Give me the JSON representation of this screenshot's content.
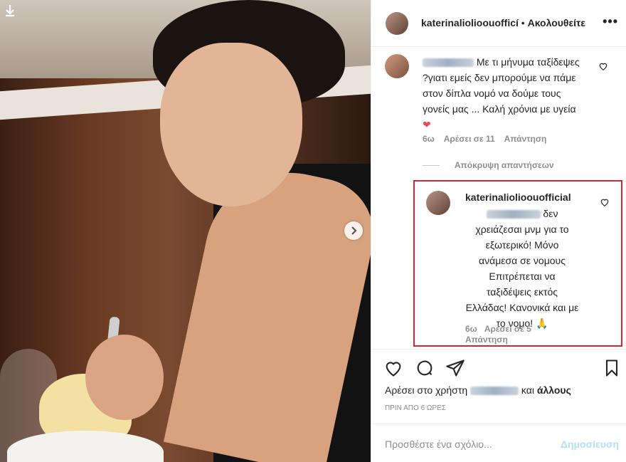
{
  "header": {
    "username": "katerinaliolioouofficí",
    "separator": "•",
    "follow_label": "Ακολουθείτε",
    "more_label": "•••"
  },
  "comment": {
    "text": "Με τι μήνυμα ταξίδεψες ?γιατι εμείς δεν μπορούμε να πάμε στον δίπλα νομό να δούμε τους γονείς μας ... Καλή χρόνια με υγεία",
    "emoji": "❤",
    "time": "6ω",
    "likes": "Αρέσει σε 11",
    "reply": "Απάντηση"
  },
  "hide_replies_label": "Απόκρυψη απαντήσεων",
  "reply": {
    "username": "katerinaliolioouofficial",
    "text_after_mention": "δεν χρειάζεσαι μνμ για το εξωτερικό! Μόνο ανάμεσα σε νομους Επιτρέπεται να ταξιδέψεις εκτός Ελλάδας! Κανονικά και με το νομο!",
    "emoji": "🙏",
    "time": "6ω",
    "likes": "Αρέσει σε 5",
    "reply": "Απάντηση"
  },
  "likes": {
    "prefix": "Αρέσει στο χρήστη",
    "and": "και",
    "others": "άλλους"
  },
  "timestamp": "ΠΡΙΝ ΑΠΟ 6 ΩΡΕΣ",
  "add_comment": {
    "placeholder": "Προσθέστε ένα σχόλιο...",
    "post_label": "Δημοσίευση"
  },
  "colors": {
    "highlight_border": "#d9262c",
    "post_button": "#b2dffc",
    "heart": "#ed4956"
  }
}
